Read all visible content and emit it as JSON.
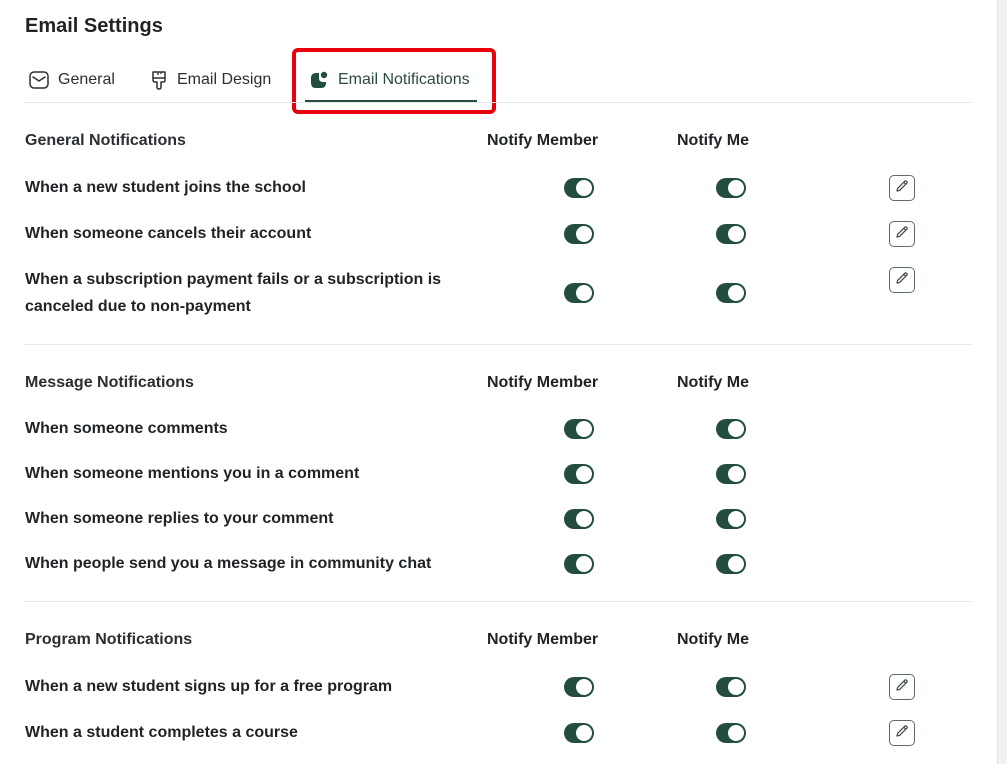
{
  "page": {
    "title": "Email Settings"
  },
  "tabs": {
    "general": "General",
    "email_design": "Email Design",
    "email_notifications": "Email Notifications"
  },
  "columns": {
    "notify_member": "Notify Member",
    "notify_me": "Notify Me"
  },
  "sections": [
    {
      "title": "General Notifications",
      "rows": [
        {
          "label": "When a new student joins the school",
          "notify_member": true,
          "notify_me": true
        },
        {
          "label": "When someone cancels their account",
          "notify_member": true,
          "notify_me": true
        },
        {
          "label": "When a subscription payment fails or a subscription is canceled due to non-payment",
          "notify_member": true,
          "notify_me": true
        }
      ]
    },
    {
      "title": "Message Notifications",
      "rows": [
        {
          "label": "When someone comments",
          "notify_member": true,
          "notify_me": true
        },
        {
          "label": "When someone mentions you in a comment",
          "notify_member": true,
          "notify_me": true
        },
        {
          "label": "When someone replies to your comment",
          "notify_member": true,
          "notify_me": true
        },
        {
          "label": "When people send you a message in community chat",
          "notify_member": true,
          "notify_me": true
        }
      ]
    },
    {
      "title": "Program Notifications",
      "rows": [
        {
          "label": "When a new student signs up for a free program",
          "notify_member": true,
          "notify_me": true
        },
        {
          "label": "When a student completes a course",
          "notify_member": true,
          "notify_me": true
        }
      ]
    }
  ],
  "icons": {
    "general": "envelope-icon",
    "email_design": "brush-icon",
    "email_notifications": "notification-badge-icon",
    "edit": "pencil-icon"
  },
  "colors": {
    "accent": "#234d40",
    "highlight": "#e8000b"
  }
}
